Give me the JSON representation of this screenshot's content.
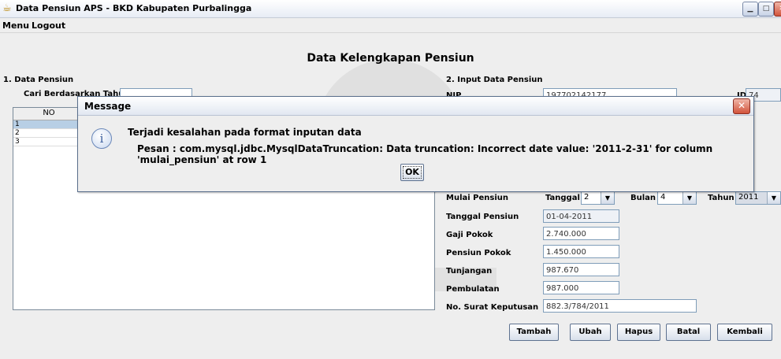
{
  "window": {
    "title": "Data Pensiun APS - BKD Kabupaten Purbalingga"
  },
  "menu": [
    "Menu",
    "Logout"
  ],
  "main_title": "Data Kelengkapan Pensiun",
  "left": {
    "section_title": "1. Data Pensiun",
    "search_label": "Cari Berdasarkan Tahun",
    "search_value": "",
    "table": {
      "columns": [
        "NO"
      ],
      "rows": [
        [
          "1"
        ],
        [
          "2"
        ],
        [
          "3"
        ]
      ]
    }
  },
  "right": {
    "section_title": "2. Input Data Pensiun",
    "nip_label": "NIP",
    "nip_value": "197702142177",
    "id_label": "ID",
    "id_value": "74",
    "mulai_label": "Mulai Pensiun",
    "tanggal_label": "Tanggal",
    "tanggal_value": "2",
    "bulan_label": "Bulan",
    "bulan_value": "4",
    "tahun_label": "Tahun",
    "tahun_value": "2011",
    "fields": [
      {
        "label": "Tanggal Pensiun",
        "value": "01-04-2011"
      },
      {
        "label": "Gaji Pokok",
        "value": "2.740.000"
      },
      {
        "label": "Pensiun Pokok",
        "value": "1.450.000"
      },
      {
        "label": "Tunjangan",
        "value": "987.670"
      },
      {
        "label": "Pembulatan",
        "value": "987.000"
      },
      {
        "label": "No. Surat Keputusan",
        "value": "882.3/784/2011"
      }
    ]
  },
  "buttons": [
    "Tambah",
    "Ubah",
    "Hapus",
    "Batal",
    "Kembali"
  ],
  "dialog": {
    "title": "Message",
    "line1": "Terjadi kesalahan pada format inputan data",
    "line2": "Pesan : com.mysql.jdbc.MysqlDataTruncation: Data truncation: Incorrect date value: '2011-2-31' for column 'mulai_pensiun' at row 1",
    "ok_label": "OK"
  },
  "colors": {
    "dialog_border": "#5a6f8c",
    "selected_row": "#b8cfe5",
    "close_red": "#d2533a"
  }
}
